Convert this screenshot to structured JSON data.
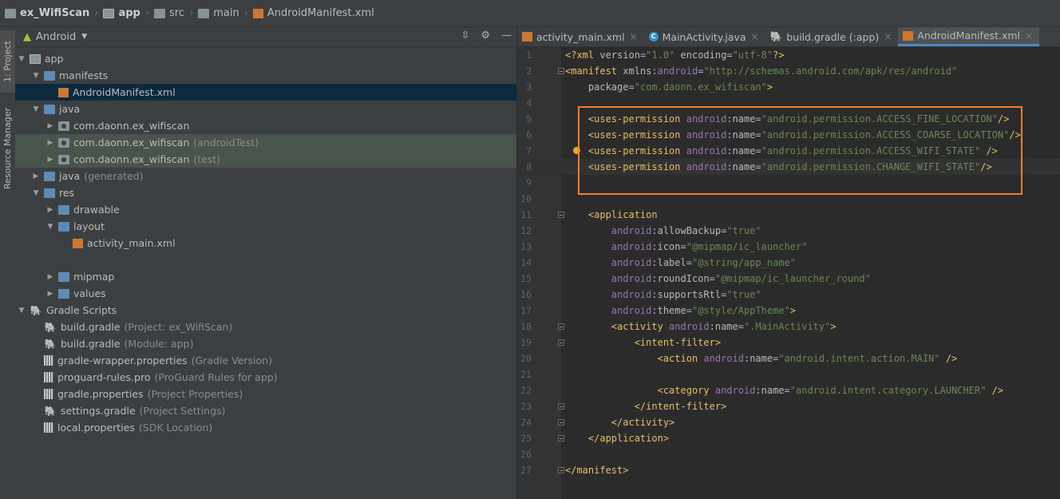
{
  "breadcrumb": [
    "ex_WifiScan",
    "app",
    "src",
    "main",
    "AndroidManifest.xml"
  ],
  "toolstrip": {
    "project_tab": "1: Project",
    "resource_tab": "Resource Manager"
  },
  "project_panel": {
    "view_selector": "Android",
    "items": [
      {
        "label": "app",
        "hint": "",
        "icon": "app-module-icon",
        "arrow": "down",
        "indent": 0
      },
      {
        "label": "manifests",
        "hint": "",
        "icon": "folder-icon",
        "arrow": "down",
        "indent": 1
      },
      {
        "label": "AndroidManifest.xml",
        "hint": "",
        "icon": "manifest-file-icon",
        "arrow": "",
        "indent": 2,
        "selected": true
      },
      {
        "label": "java",
        "hint": "",
        "icon": "folder-icon",
        "arrow": "down",
        "indent": 1
      },
      {
        "label": "com.daonn.ex_wifiscan",
        "hint": "",
        "icon": "package-icon",
        "arrow": "right",
        "indent": 2
      },
      {
        "label": "com.daonn.ex_wifiscan",
        "hint": "(androidTest)",
        "icon": "package-icon",
        "arrow": "right",
        "indent": 2,
        "highlighted": true
      },
      {
        "label": "com.daonn.ex_wifiscan",
        "hint": "(test)",
        "icon": "package-icon",
        "arrow": "right",
        "indent": 2,
        "highlighted": true
      },
      {
        "label": "java",
        "hint": "(generated)",
        "icon": "folder-icon",
        "arrow": "right",
        "indent": 1
      },
      {
        "label": "res",
        "hint": "",
        "icon": "folder-icon",
        "arrow": "down",
        "indent": 1
      },
      {
        "label": "drawable",
        "hint": "",
        "icon": "folder-icon",
        "arrow": "right",
        "indent": 2
      },
      {
        "label": "layout",
        "hint": "",
        "icon": "folder-icon",
        "arrow": "down",
        "indent": 2
      },
      {
        "label": "activity_main.xml",
        "hint": "",
        "icon": "xml-file-icon",
        "arrow": "",
        "indent": 3
      },
      {
        "label": "",
        "hint": "",
        "icon": "",
        "arrow": "",
        "indent": 3
      },
      {
        "label": "mipmap",
        "hint": "",
        "icon": "folder-icon",
        "arrow": "right",
        "indent": 2
      },
      {
        "label": "values",
        "hint": "",
        "icon": "folder-icon",
        "arrow": "right",
        "indent": 2
      },
      {
        "label": "Gradle Scripts",
        "hint": "",
        "icon": "gradle-icon",
        "arrow": "down",
        "indent": 0
      },
      {
        "label": "build.gradle",
        "hint": "(Project: ex_WifiScan)",
        "icon": "gradle-icon",
        "arrow": "",
        "indent": 1
      },
      {
        "label": "build.gradle",
        "hint": "(Module: app)",
        "icon": "gradle-icon",
        "arrow": "",
        "indent": 1
      },
      {
        "label": "gradle-wrapper.properties",
        "hint": "(Gradle Version)",
        "icon": "properties-file-icon",
        "arrow": "",
        "indent": 1
      },
      {
        "label": "proguard-rules.pro",
        "hint": "(ProGuard Rules for app)",
        "icon": "text-file-icon",
        "arrow": "",
        "indent": 1
      },
      {
        "label": "gradle.properties",
        "hint": "(Project Properties)",
        "icon": "properties-file-icon",
        "arrow": "",
        "indent": 1
      },
      {
        "label": "settings.gradle",
        "hint": "(Project Settings)",
        "icon": "gradle-icon",
        "arrow": "",
        "indent": 1
      },
      {
        "label": "local.properties",
        "hint": "(SDK Location)",
        "icon": "properties-file-icon",
        "arrow": "",
        "indent": 1
      }
    ]
  },
  "editor": {
    "tabs": [
      {
        "label": "activity_main.xml",
        "icon": "xml-file-icon",
        "active": false
      },
      {
        "label": "MainActivity.java",
        "icon": "java-class-icon",
        "active": false
      },
      {
        "label": "build.gradle (:app)",
        "icon": "gradle-icon",
        "active": false
      },
      {
        "label": "AndroidManifest.xml",
        "icon": "manifest-file-icon",
        "active": true
      }
    ],
    "current_line": 8,
    "lines": [
      {
        "n": "1",
        "parts": [
          [
            "pi",
            "<?xml "
          ],
          [
            "attr",
            "version"
          ],
          [
            "plain",
            "="
          ],
          [
            "val",
            "\"1.0\""
          ],
          [
            "plain",
            " "
          ],
          [
            "attr",
            "encoding"
          ],
          [
            "plain",
            "="
          ],
          [
            "val",
            "\"utf-8\""
          ],
          [
            "pi",
            "?>"
          ]
        ]
      },
      {
        "n": "2",
        "parts": [
          [
            "tag",
            "<manifest "
          ],
          [
            "attr",
            "xmlns:"
          ],
          [
            "ns",
            "android"
          ],
          [
            "plain",
            "="
          ],
          [
            "val",
            "\"http://schemas.android.com/apk/res/android\""
          ]
        ]
      },
      {
        "n": "3",
        "parts": [
          [
            "plain",
            "    "
          ],
          [
            "attr",
            "package"
          ],
          [
            "plain",
            "="
          ],
          [
            "val",
            "\"com.daonn.ex_wifiscan\""
          ],
          [
            "tag",
            ">"
          ]
        ]
      },
      {
        "n": "4",
        "parts": []
      },
      {
        "n": "5",
        "parts": [
          [
            "plain",
            "    "
          ],
          [
            "tag",
            "<uses-permission "
          ],
          [
            "ns",
            "android"
          ],
          [
            "attr",
            ":name"
          ],
          [
            "plain",
            "="
          ],
          [
            "val",
            "\"android.permission.ACCESS_FINE_LOCATION\""
          ],
          [
            "tag",
            "/>"
          ]
        ]
      },
      {
        "n": "6",
        "parts": [
          [
            "plain",
            "    "
          ],
          [
            "tag",
            "<uses-permission "
          ],
          [
            "ns",
            "android"
          ],
          [
            "attr",
            ":name"
          ],
          [
            "plain",
            "="
          ],
          [
            "val",
            "\"android.permission.ACCESS_COARSE_LOCATION\""
          ],
          [
            "tag",
            "/>"
          ]
        ]
      },
      {
        "n": "7",
        "parts": [
          [
            "plain",
            "    "
          ],
          [
            "tag",
            "<uses-permission "
          ],
          [
            "ns",
            "android"
          ],
          [
            "attr",
            ":name"
          ],
          [
            "plain",
            "="
          ],
          [
            "val",
            "\"android.permission.ACCESS_WIFI_STATE\""
          ],
          [
            "plain",
            " "
          ],
          [
            "tag",
            "/>"
          ]
        ]
      },
      {
        "n": "8",
        "parts": [
          [
            "plain",
            "    "
          ],
          [
            "tag",
            "<uses-permission "
          ],
          [
            "ns",
            "android"
          ],
          [
            "attr",
            ":name"
          ],
          [
            "plain",
            "="
          ],
          [
            "val",
            "\"android.permission.CHANGE_WIFI_STATE\""
          ],
          [
            "tag",
            "/>"
          ]
        ]
      },
      {
        "n": "9",
        "parts": []
      },
      {
        "n": "10",
        "parts": []
      },
      {
        "n": "11",
        "parts": [
          [
            "plain",
            "    "
          ],
          [
            "tag",
            "<application"
          ]
        ]
      },
      {
        "n": "12",
        "parts": [
          [
            "plain",
            "        "
          ],
          [
            "ns",
            "android"
          ],
          [
            "attr",
            ":allowBackup"
          ],
          [
            "plain",
            "="
          ],
          [
            "val",
            "\"true\""
          ]
        ]
      },
      {
        "n": "13",
        "parts": [
          [
            "plain",
            "        "
          ],
          [
            "ns",
            "android"
          ],
          [
            "attr",
            ":icon"
          ],
          [
            "plain",
            "="
          ],
          [
            "val",
            "\"@mipmap/ic_launcher\""
          ]
        ]
      },
      {
        "n": "14",
        "parts": [
          [
            "plain",
            "        "
          ],
          [
            "ns",
            "android"
          ],
          [
            "attr",
            ":label"
          ],
          [
            "plain",
            "="
          ],
          [
            "val",
            "\"@string/app_name\""
          ]
        ]
      },
      {
        "n": "15",
        "parts": [
          [
            "plain",
            "        "
          ],
          [
            "ns",
            "android"
          ],
          [
            "attr",
            ":roundIcon"
          ],
          [
            "plain",
            "="
          ],
          [
            "val",
            "\"@mipmap/ic_launcher_round\""
          ]
        ]
      },
      {
        "n": "16",
        "parts": [
          [
            "plain",
            "        "
          ],
          [
            "ns",
            "android"
          ],
          [
            "attr",
            ":supportsRtl"
          ],
          [
            "plain",
            "="
          ],
          [
            "val",
            "\"true\""
          ]
        ]
      },
      {
        "n": "17",
        "parts": [
          [
            "plain",
            "        "
          ],
          [
            "ns",
            "android"
          ],
          [
            "attr",
            ":theme"
          ],
          [
            "plain",
            "="
          ],
          [
            "val",
            "\"@style/AppTheme\""
          ],
          [
            "tag",
            ">"
          ]
        ]
      },
      {
        "n": "18",
        "parts": [
          [
            "plain",
            "        "
          ],
          [
            "tag",
            "<activity "
          ],
          [
            "ns",
            "android"
          ],
          [
            "attr",
            ":name"
          ],
          [
            "plain",
            "="
          ],
          [
            "val",
            "\".MainActivity\""
          ],
          [
            "tag",
            ">"
          ]
        ]
      },
      {
        "n": "19",
        "parts": [
          [
            "plain",
            "            "
          ],
          [
            "tag",
            "<intent-filter>"
          ]
        ]
      },
      {
        "n": "20",
        "parts": [
          [
            "plain",
            "                "
          ],
          [
            "tag",
            "<action "
          ],
          [
            "ns",
            "android"
          ],
          [
            "attr",
            ":name"
          ],
          [
            "plain",
            "="
          ],
          [
            "val",
            "\"android.intent.action.MAIN\""
          ],
          [
            "plain",
            " "
          ],
          [
            "tag",
            "/>"
          ]
        ]
      },
      {
        "n": "21",
        "parts": []
      },
      {
        "n": "22",
        "parts": [
          [
            "plain",
            "                "
          ],
          [
            "tag",
            "<category "
          ],
          [
            "ns",
            "android"
          ],
          [
            "attr",
            ":name"
          ],
          [
            "plain",
            "="
          ],
          [
            "val",
            "\"android.intent.category.LAUNCHER\""
          ],
          [
            "plain",
            " "
          ],
          [
            "tag",
            "/>"
          ]
        ]
      },
      {
        "n": "23",
        "parts": [
          [
            "plain",
            "            "
          ],
          [
            "tag",
            "</intent-filter>"
          ]
        ]
      },
      {
        "n": "24",
        "parts": [
          [
            "plain",
            "        "
          ],
          [
            "tag",
            "</activity>"
          ]
        ]
      },
      {
        "n": "25",
        "parts": [
          [
            "plain",
            "    "
          ],
          [
            "tag",
            "</application>"
          ]
        ]
      },
      {
        "n": "26",
        "parts": []
      },
      {
        "n": "27",
        "parts": [
          [
            "tag",
            "</manifest>"
          ]
        ]
      }
    ]
  },
  "colors": {
    "highlight_box": "#f07f2f",
    "selected_row": "#0d293e",
    "active_tab_underline": "#4a88c7"
  }
}
